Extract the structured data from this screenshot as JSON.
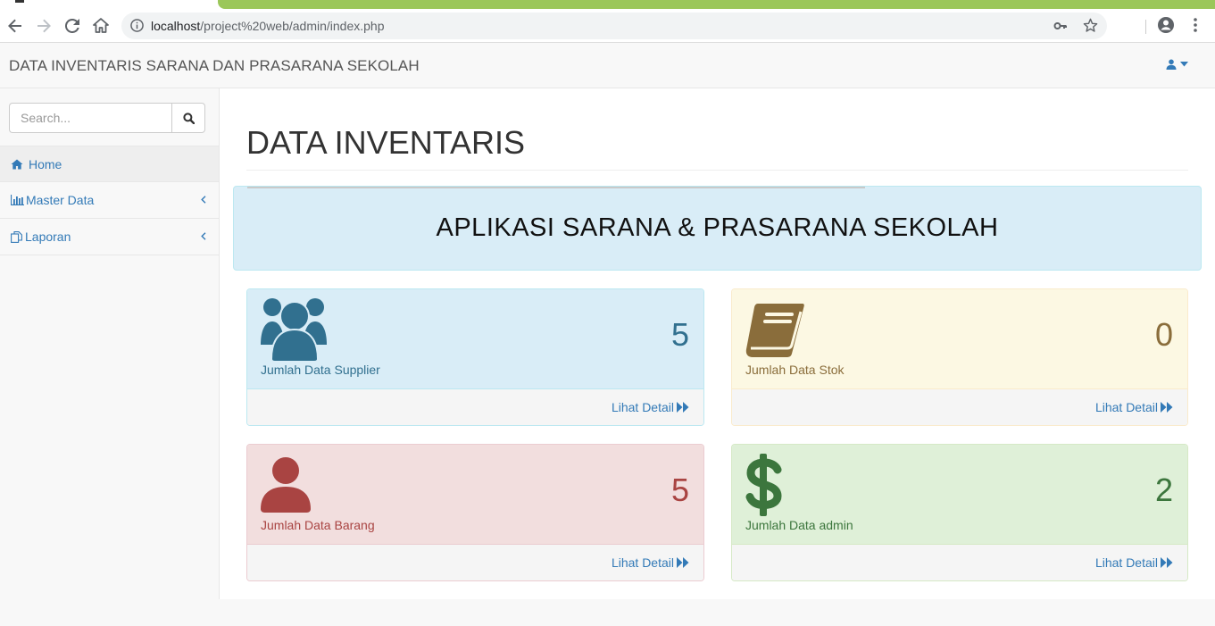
{
  "browser": {
    "url_host": "localhost",
    "url_path": "/project%20web/admin/index.php"
  },
  "app": {
    "brand": "DATA INVENTARIS SARANA DAN PRASARANA SEKOLAH"
  },
  "sidebar": {
    "search_placeholder": "Search...",
    "items": [
      {
        "label": "Home",
        "icon": "home-icon"
      },
      {
        "label": "Master Data",
        "icon": "bar-chart-icon"
      },
      {
        "label": "Laporan",
        "icon": "files-icon"
      }
    ]
  },
  "main": {
    "title": "DATA INVENTARIS",
    "banner": "APLIKASI SARANA & PRASARANA SEKOLAH",
    "panels": [
      {
        "count": "5",
        "label": "Jumlah Data Supplier",
        "link": "Lihat Detail",
        "icon": "users-icon",
        "color": "#31708f"
      },
      {
        "count": "0",
        "label": "Jumlah Data Stok",
        "link": "Lihat Detail",
        "icon": "book-icon",
        "color": "#8a6d3b"
      },
      {
        "count": "5",
        "label": "Jumlah Data Barang",
        "link": "Lihat Detail",
        "icon": "user-icon",
        "color": "#a94442"
      },
      {
        "count": "2",
        "label": "Jumlah Data admin",
        "link": "Lihat Detail",
        "icon": "dollar-icon",
        "color": "#3c763d"
      }
    ]
  }
}
